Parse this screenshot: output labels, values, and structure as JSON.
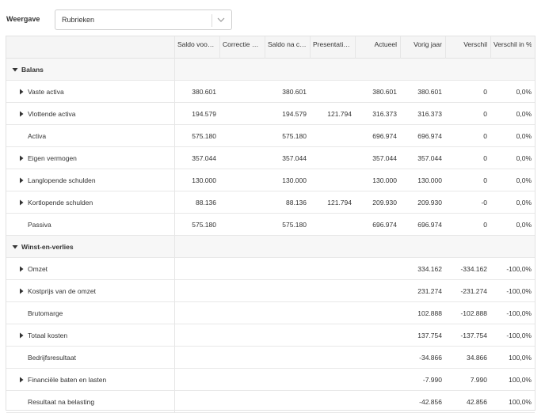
{
  "toolbar": {
    "view_label": "Weergave",
    "view_value": "Rubrieken"
  },
  "columns": [
    "Saldo voor…",
    "Correctie …",
    "Saldo na c…",
    "Presentati…",
    "Actueel",
    "Vorig jaar",
    "Verschil",
    "Verschil in %"
  ],
  "rows": [
    {
      "type": "group",
      "label": "Balans",
      "expanded": true,
      "values": [
        "",
        "",
        "",
        "",
        "",
        "",
        "",
        ""
      ]
    },
    {
      "type": "item",
      "label": "Vaste activa",
      "expandable": true,
      "values": [
        "380.601",
        "",
        "380.601",
        "",
        "380.601",
        "380.601",
        "0",
        "0,0%"
      ]
    },
    {
      "type": "item",
      "label": "Vlottende activa",
      "expandable": true,
      "values": [
        "194.579",
        "",
        "194.579",
        "121.794",
        "316.373",
        "316.373",
        "0",
        "0,0%"
      ]
    },
    {
      "type": "item",
      "label": "Activa",
      "expandable": false,
      "values": [
        "575.180",
        "",
        "575.180",
        "",
        "696.974",
        "696.974",
        "0",
        "0,0%"
      ]
    },
    {
      "type": "item",
      "label": "Eigen vermogen",
      "expandable": true,
      "values": [
        "357.044",
        "",
        "357.044",
        "",
        "357.044",
        "357.044",
        "0",
        "0,0%"
      ]
    },
    {
      "type": "item",
      "label": "Langlopende schulden",
      "expandable": true,
      "values": [
        "130.000",
        "",
        "130.000",
        "",
        "130.000",
        "130.000",
        "0",
        "0,0%"
      ]
    },
    {
      "type": "item",
      "label": "Kortlopende schulden",
      "expandable": true,
      "values": [
        "88.136",
        "",
        "88.136",
        "121.794",
        "209.930",
        "209.930",
        "-0",
        "0,0%"
      ]
    },
    {
      "type": "item",
      "label": "Passiva",
      "expandable": false,
      "values": [
        "575.180",
        "",
        "575.180",
        "",
        "696.974",
        "696.974",
        "0",
        "0,0%"
      ]
    },
    {
      "type": "group",
      "label": "Winst-en-verlies",
      "expanded": true,
      "values": [
        "",
        "",
        "",
        "",
        "",
        "",
        "",
        ""
      ]
    },
    {
      "type": "item",
      "label": "Omzet",
      "expandable": true,
      "values": [
        "",
        "",
        "",
        "",
        "",
        "334.162",
        "-334.162",
        "-100,0%"
      ]
    },
    {
      "type": "item",
      "label": "Kostprijs van de omzet",
      "expandable": true,
      "values": [
        "",
        "",
        "",
        "",
        "",
        "231.274",
        "-231.274",
        "-100,0%"
      ]
    },
    {
      "type": "item",
      "label": "Brutomarge",
      "expandable": false,
      "values": [
        "",
        "",
        "",
        "",
        "",
        "102.888",
        "-102.888",
        "-100,0%"
      ]
    },
    {
      "type": "item",
      "label": "Totaal kosten",
      "expandable": true,
      "values": [
        "",
        "",
        "",
        "",
        "",
        "137.754",
        "-137.754",
        "-100,0%"
      ]
    },
    {
      "type": "item",
      "label": "Bedrijfsresultaat",
      "expandable": false,
      "values": [
        "",
        "",
        "",
        "",
        "",
        "-34.866",
        "34.866",
        "100,0%"
      ]
    },
    {
      "type": "item",
      "label": "Financiële baten en lasten",
      "expandable": true,
      "values": [
        "",
        "",
        "",
        "",
        "",
        "-7.990",
        "7.990",
        "100,0%"
      ]
    },
    {
      "type": "item",
      "label": "Resultaat na belasting",
      "expandable": false,
      "values": [
        "",
        "",
        "",
        "",
        "",
        "-42.856",
        "42.856",
        "100,0%"
      ]
    }
  ]
}
